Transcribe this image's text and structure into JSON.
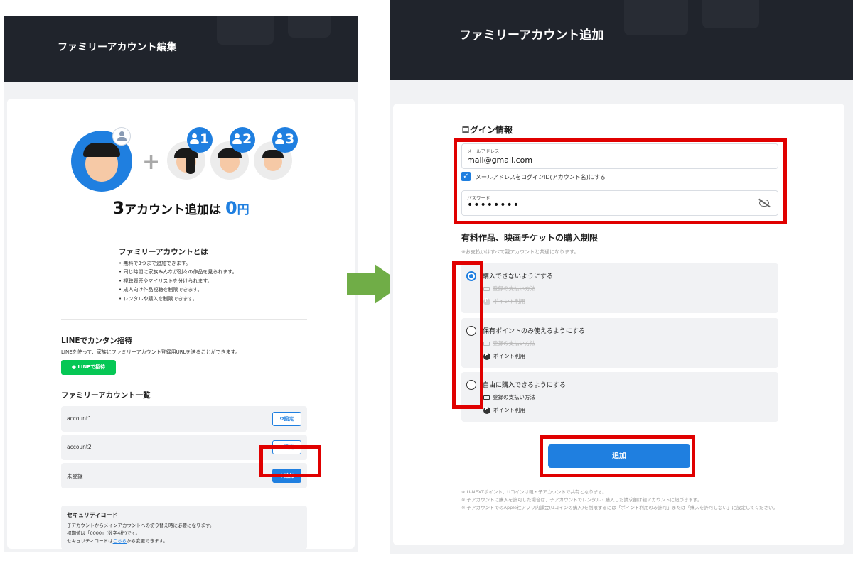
{
  "left": {
    "title": "ファミリーアカウント編集",
    "badges": [
      "1",
      "2",
      "3"
    ],
    "promo": {
      "count": "3",
      "mid": "アカウント追加は",
      "price": "0",
      "unit": "円"
    },
    "about": {
      "title": "ファミリーアカウントとは",
      "items": [
        "無料で3つまで追加できます。",
        "同じ時間に家族みんなが別々の作品を見られます。",
        "視聴履歴やマイリストを分けられます。",
        "成人向け作品視聴を制限できます。",
        "レンタルや購入を制限できます。"
      ]
    },
    "line": {
      "title": "LINEでカンタン招待",
      "desc": "LINEを使って、家族にファミリーアカウント登録用URLを送ることができます。",
      "button": "LINEで招待"
    },
    "list": {
      "title": "ファミリーアカウント一覧",
      "rows": [
        {
          "name": "account1",
          "button": "設定"
        },
        {
          "name": "account2",
          "button": "設定"
        },
        {
          "name": "未登録",
          "button": "＋追加"
        }
      ]
    },
    "security": {
      "title": "セキュリティコード",
      "line1": "子アカウントからメインアカウントへの切り替え時に必要になります。",
      "line2": "初期値は「0000」(数字4桁)です。",
      "line3_pre": "セキュリティコードは",
      "line3_link": "こちら",
      "line3_post": "から変更できます。"
    }
  },
  "right": {
    "title": "ファミリーアカウント追加",
    "login": {
      "title": "ログイン情報",
      "email_label": "メールアドレス",
      "email_value": "mail@gmail.com",
      "checkbox_label": "メールアドレスをログインID(アカウント名)にする",
      "password_label": "パスワード",
      "password_value": "••••••••"
    },
    "purchase": {
      "title": "有料作品、映画チケットの購入制限",
      "note": "※お支払いはすべて親アカウントと共通になります。",
      "options": [
        {
          "label": "購入できないようにする",
          "sub1": "登録の支払い方法",
          "sub2": "ポイント利用",
          "selected": true
        },
        {
          "label": "保有ポイントのみ使えるようにする",
          "sub1": "登録の支払い方法",
          "sub2": "ポイント利用",
          "selected": false
        },
        {
          "label": "自由に購入できるようにする",
          "sub1": "登録の支払い方法",
          "sub2": "ポイント利用",
          "selected": false
        }
      ]
    },
    "add_button": "追加",
    "footnotes": [
      "※ U-NEXTポイント、Uコインは親・子アカウントで共有となります。",
      "※ 子アカウントに購入を許可した場合は、子アカウントでレンタル・購入した請求額は親アカウントに紐づきます。",
      "※ 子アカウントでのApple社アプリ内課金(Uコインの購入)を制限するには「ポイント利用のみ許可」または「購入を許可しない」に設定してください。"
    ]
  },
  "colors": {
    "accent": "#1f7fe0",
    "header": "#20242c",
    "line_green": "#06c755",
    "highlight_red": "#e00000",
    "arrow_green": "#70ad47"
  }
}
